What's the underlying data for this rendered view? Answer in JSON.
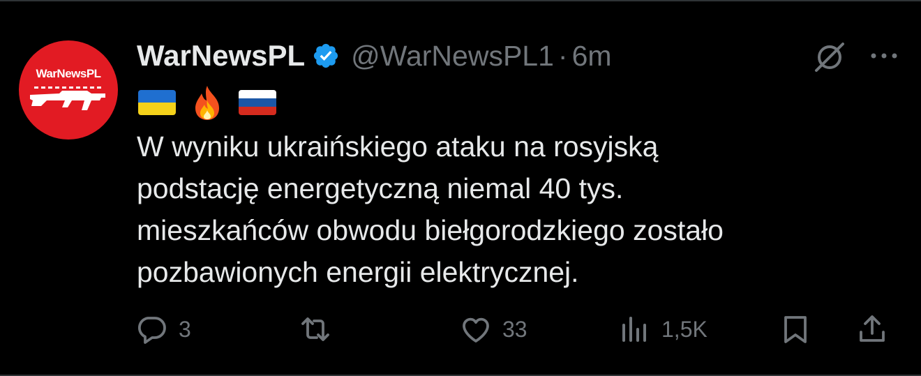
{
  "author": {
    "name": "WarNewsPL",
    "handle": "@WarNewsPL1",
    "separator": "·",
    "time": "6m",
    "avatar_text": "WarNewsPL",
    "verified": true
  },
  "icons": {
    "flags": [
      "ukraine-flag-icon",
      "fire-icon",
      "russia-flag-icon"
    ],
    "header_right": [
      "grok-icon",
      "more-icon"
    ]
  },
  "tweet": {
    "lines": [
      "W wyniku ukraińskiego ataku na rosyjską",
      "podstację energetyczną niemal 40 tys.",
      "mieszkańców obwodu biełgorodzkiego zostało",
      "pozbawionych energii elektrycznej."
    ]
  },
  "actions": {
    "replies": "3",
    "retweets": "",
    "likes": "33",
    "views": "1,5K"
  },
  "colors": {
    "background": "#000000",
    "text": "#e7e9ea",
    "muted": "#71767b",
    "verified": "#1d9bf0",
    "avatar": "#e21b23"
  }
}
